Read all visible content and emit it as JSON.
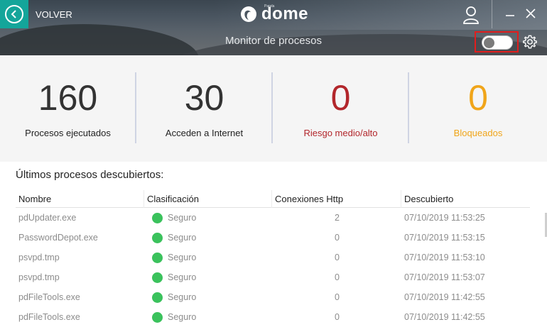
{
  "topbar": {
    "back_label": "VOLVER",
    "logo_text": "dome",
    "logo_small": "Panda"
  },
  "header": {
    "title": "Monitor de procesos",
    "toggle_state": "off"
  },
  "stats": [
    {
      "value": "160",
      "label": "Procesos ejecutados"
    },
    {
      "value": "30",
      "label": "Acceden a Internet"
    },
    {
      "value": "0",
      "label": "Riesgo medio/alto"
    },
    {
      "value": "0",
      "label": "Bloqueados"
    }
  ],
  "colors": {
    "accent": "#14a59a",
    "risk": "#b2262b",
    "blocked": "#f0a51a",
    "safe": "#3ac25c",
    "highlight": "#e11d1d"
  },
  "table": {
    "title": "Últimos procesos descubiertos:",
    "columns": [
      "Nombre",
      "Clasificación",
      "Conexiones Http",
      "Descubierto"
    ],
    "rows": [
      {
        "name": "pdUpdater.exe",
        "class": "Seguro",
        "http": "2",
        "date": "07/10/2019 11:53:25"
      },
      {
        "name": "PasswordDepot.exe",
        "class": "Seguro",
        "http": "0",
        "date": "07/10/2019 11:53:15"
      },
      {
        "name": "psvpd.tmp",
        "class": "Seguro",
        "http": "0",
        "date": "07/10/2019 11:53:10"
      },
      {
        "name": "psvpd.tmp",
        "class": "Seguro",
        "http": "0",
        "date": "07/10/2019 11:53:07"
      },
      {
        "name": "pdFileTools.exe",
        "class": "Seguro",
        "http": "0",
        "date": "07/10/2019 11:42:55"
      },
      {
        "name": "pdFileTools.exe",
        "class": "Seguro",
        "http": "0",
        "date": "07/10/2019 11:42:55"
      }
    ]
  },
  "icons": {
    "back": "arrow-left-circle-icon",
    "user": "user-icon",
    "minimize": "minimize-icon",
    "close": "close-icon",
    "settings": "gear-icon",
    "logo": "dome-logo-icon",
    "status": "green-dot-icon"
  }
}
